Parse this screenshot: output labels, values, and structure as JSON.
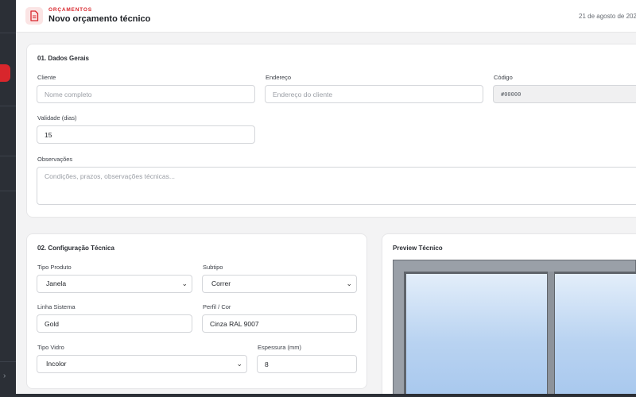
{
  "header": {
    "breadcrumb": "ORÇAMENTOS",
    "title": "Novo orçamento técnico",
    "date": "21 de agosto de 202"
  },
  "general": {
    "section_title": "01. Dados Gerais",
    "cliente_label": "Cliente",
    "cliente_placeholder": "Nome completo",
    "endereco_label": "Endereço",
    "endereco_placeholder": "Endereço do cliente",
    "codigo_label": "Código",
    "codigo_value": "#00000",
    "validade_label": "Validade (dias)",
    "validade_value": "15",
    "observacoes_label": "Observações",
    "observacoes_placeholder": "Condições, prazos, observações técnicas..."
  },
  "tech": {
    "section_title": "02. Configuração Técnica",
    "tipo_produto_label": "Tipo Produto",
    "tipo_produto_value": "Janela",
    "subtipo_label": "Subtipo",
    "subtipo_value": "Correr",
    "linha_sistema_label": "Linha Sistema",
    "linha_sistema_value": "Gold",
    "perfil_cor_label": "Perfil / Cor",
    "perfil_cor_value": "Cinza RAL 9007",
    "tipo_vidro_label": "Tipo Vidro",
    "tipo_vidro_value": "Incolor",
    "espessura_label": "Espessura (mm)",
    "espessura_value": "8"
  },
  "preview": {
    "title": "Preview Técnico"
  },
  "icons": {
    "document": "document-icon",
    "chevron": "chevron-down-icon",
    "collapse": "collapse-arrow-icon"
  },
  "colors": {
    "accent": "#d8262c",
    "sidebar": "#2b2f36",
    "glass": "#b9d3f1"
  }
}
